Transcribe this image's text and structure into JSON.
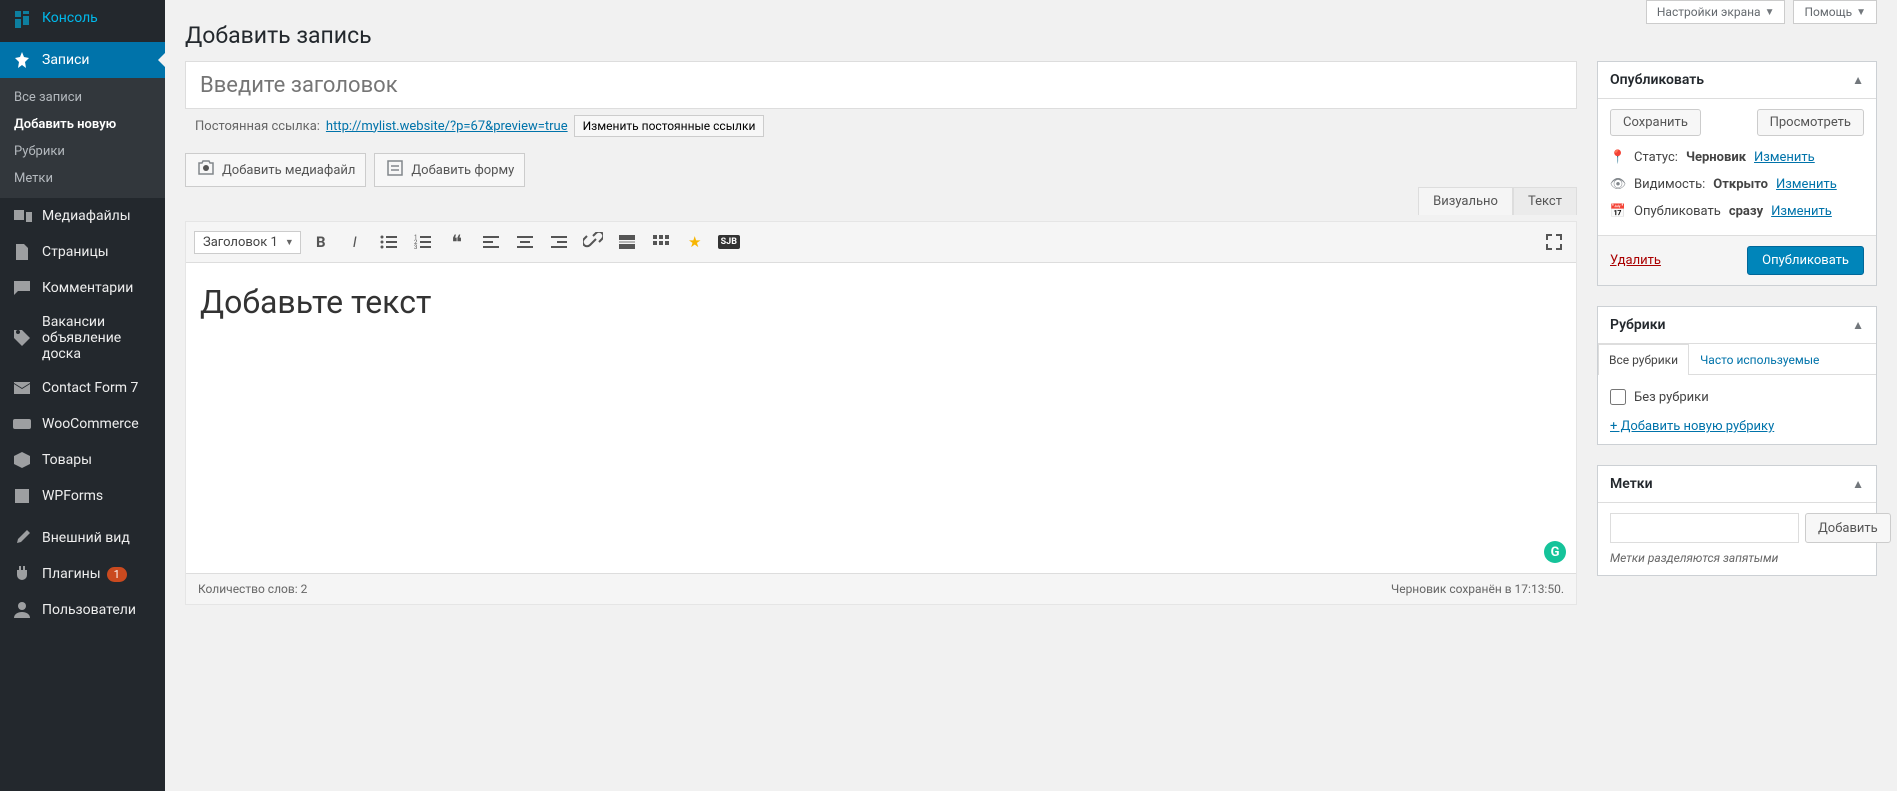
{
  "sidebar": {
    "console": "Консоль",
    "posts": "Записи",
    "posts_sub": {
      "all": "Все записи",
      "add": "Добавить новую",
      "categories": "Рубрики",
      "tags": "Метки"
    },
    "media": "Медиафайлы",
    "pages": "Страницы",
    "comments": "Комментарии",
    "jobs": "Вакансии объявление доска",
    "cf7": "Contact Form 7",
    "woo": "WooCommerce",
    "products": "Товары",
    "wpforms": "WPForms",
    "appearance": "Внешний вид",
    "plugins": "Плагины",
    "plugins_badge": "1",
    "users": "Пользователи"
  },
  "top": {
    "screen_options": "Настройки экрана",
    "help": "Помощь"
  },
  "page_title": "Добавить запись",
  "title_placeholder": "Введите заголовок",
  "permalink": {
    "label": "Постоянная ссылка:",
    "url": "http://mylist.website/?p=67&preview=true",
    "edit_btn": "Изменить постоянные ссылки"
  },
  "media_buttons": {
    "add_media": "Добавить медиафайл",
    "add_form": "Добавить форму"
  },
  "editor": {
    "tab_visual": "Визуально",
    "tab_text": "Текст",
    "format_selector": "Заголовок 1",
    "body_text": "Добавьте текст"
  },
  "status_bar": {
    "word_count": "Количество слов: 2",
    "saved": "Черновик сохранён в 17:13:50."
  },
  "publish_box": {
    "title": "Опубликовать",
    "save_draft": "Сохранить",
    "preview": "Просмотреть",
    "status_label": "Статус:",
    "status_value": "Черновик",
    "visibility_label": "Видимость:",
    "visibility_value": "Открыто",
    "schedule_label": "Опубликовать",
    "schedule_value": "сразу",
    "edit": "Изменить",
    "delete": "Удалить",
    "publish_btn": "Опубликовать"
  },
  "categories_box": {
    "title": "Рубрики",
    "tab_all": "Все рубрики",
    "tab_used": "Часто используемые",
    "uncategorized": "Без рубрики",
    "add_new": "+ Добавить новую рубрику"
  },
  "tags_box": {
    "title": "Метки",
    "add_btn": "Добавить",
    "hint": "Метки разделяются запятыми"
  }
}
